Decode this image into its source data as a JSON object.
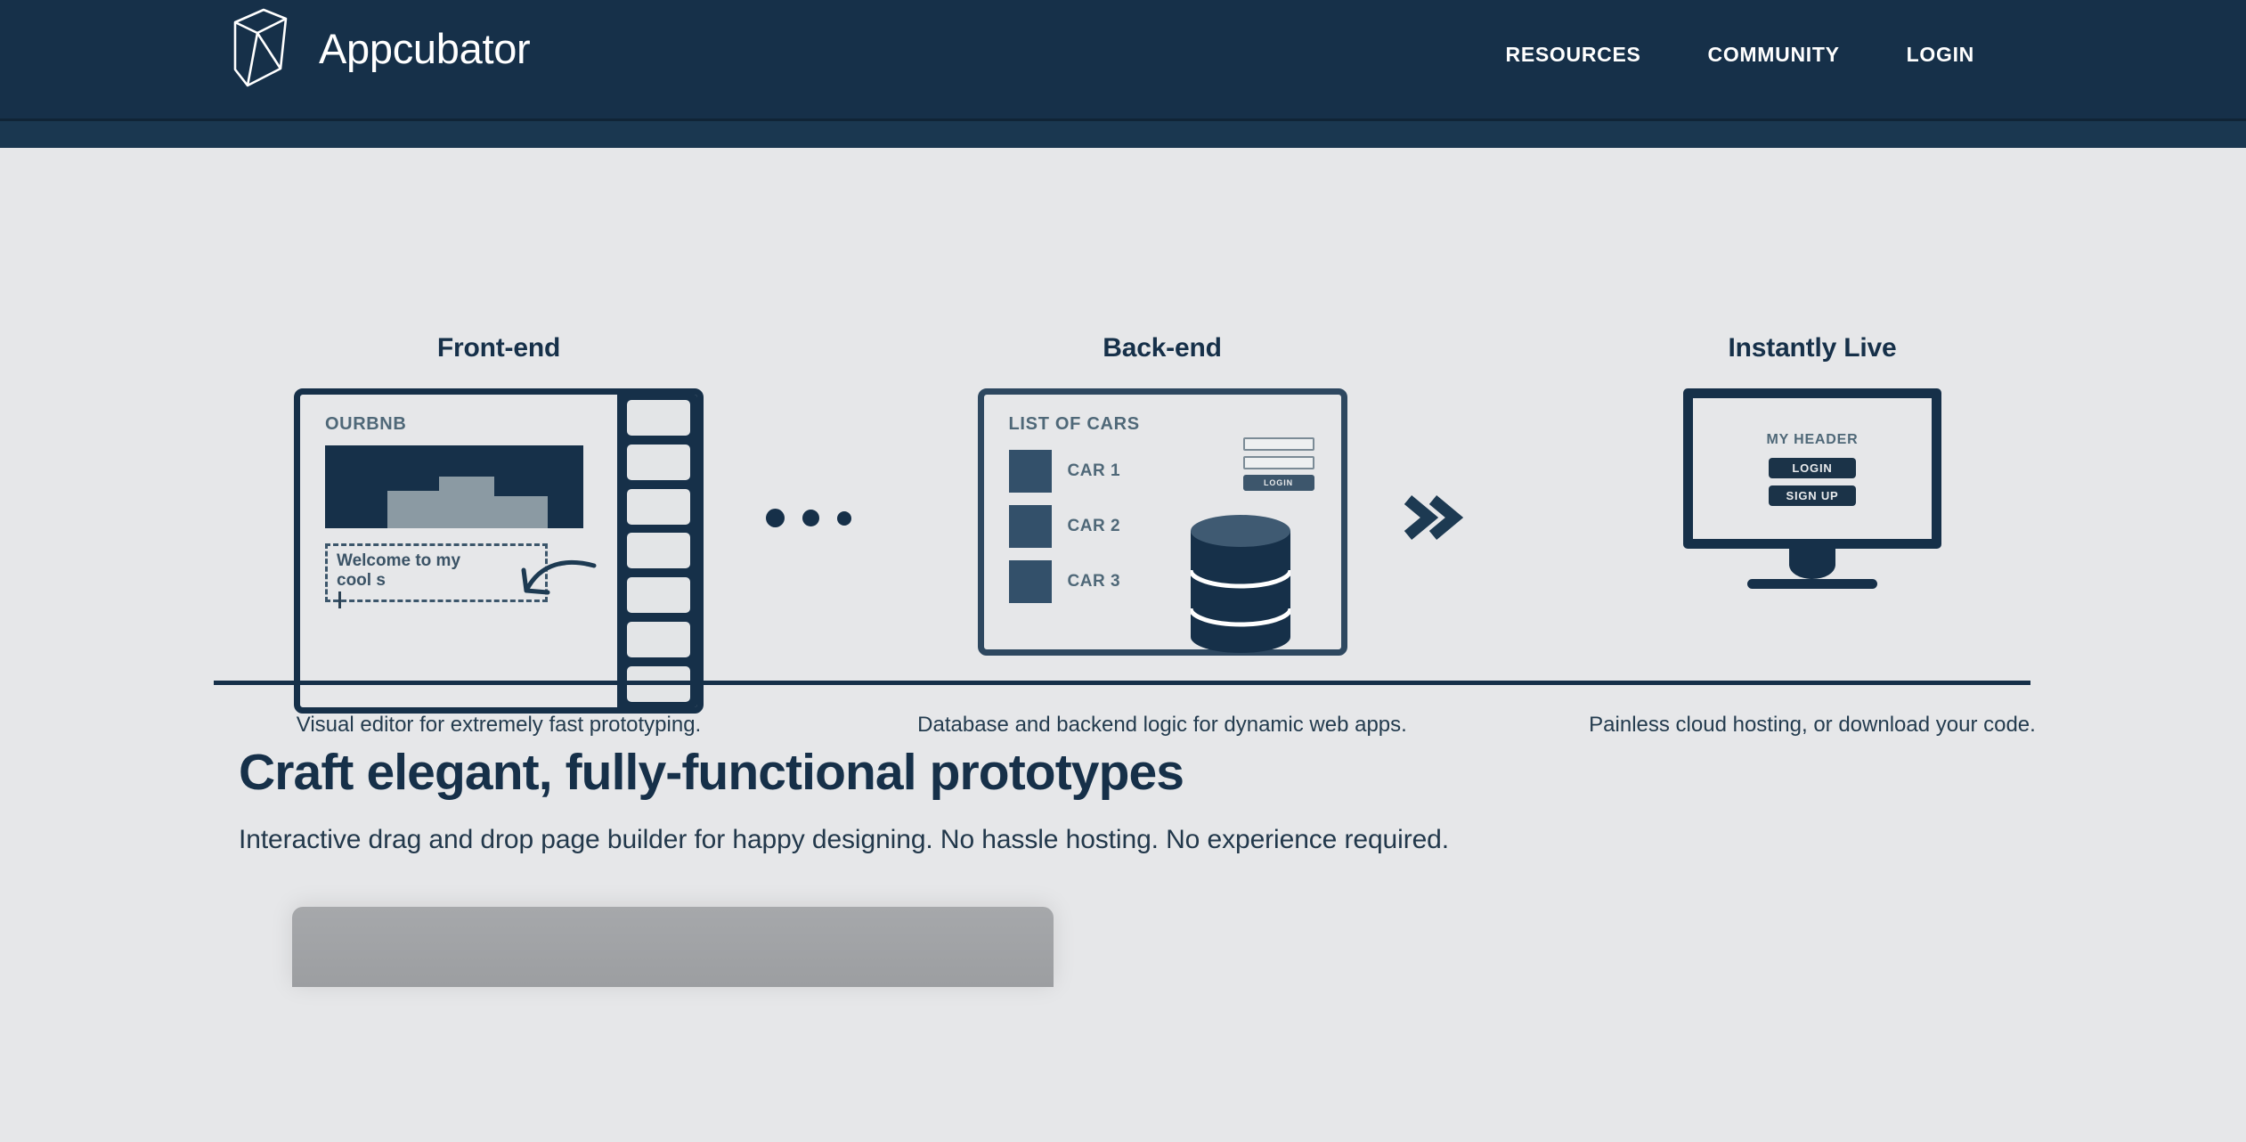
{
  "header": {
    "brand_name": "Appcubator",
    "logo_icon": "isometric-cube-logo-icon",
    "nav": [
      {
        "label": "RESOURCES"
      },
      {
        "label": "COMMUNITY"
      },
      {
        "label": "LOGIN"
      }
    ]
  },
  "features": {
    "front": {
      "title": "Front-end",
      "caption": "Visual editor for extremely fast prototyping.",
      "mock": {
        "app_name": "OURBNB",
        "hero_icon": "building-skyline-image",
        "text_block": {
          "line1": "Welcome to my",
          "line2": "cool s"
        },
        "widget_count": 7,
        "arrow_icon": "curved-drag-arrow-icon"
      }
    },
    "back": {
      "title": "Back-end",
      "caption": "Database and backend logic for dynamic web apps.",
      "mock": {
        "list_title": "LIST OF CARS",
        "items": [
          {
            "label": "CAR 1"
          },
          {
            "label": "CAR 2"
          },
          {
            "label": "CAR 3"
          }
        ],
        "login_form": {
          "field_count": 2,
          "button_label": "LOGIN"
        },
        "database_icon": "database-cylinder-icon"
      }
    },
    "live": {
      "title": "Instantly Live",
      "caption": "Painless cloud hosting, or download your code.",
      "mock": {
        "page_header": "MY HEADER",
        "buttons": [
          {
            "label": "LOGIN"
          },
          {
            "label": "SIGN UP"
          }
        ],
        "device_icon": "desktop-monitor-icon"
      }
    },
    "connector_dots_icon": "three-dots-connector-icon",
    "connector_chevron_icon": "double-chevron-right-icon"
  },
  "lower": {
    "title": "Craft elegant, fully-functional prototypes",
    "subtitle": "Interactive drag and drop page builder for happy designing. No hassle hosting. No experience required."
  },
  "colors": {
    "page_background": "#e6e7e9",
    "header_background": "#163049",
    "brand_navy": "#163049",
    "muted_slate": "#4f6878",
    "silhouette_gray": "#8b9aa3"
  }
}
